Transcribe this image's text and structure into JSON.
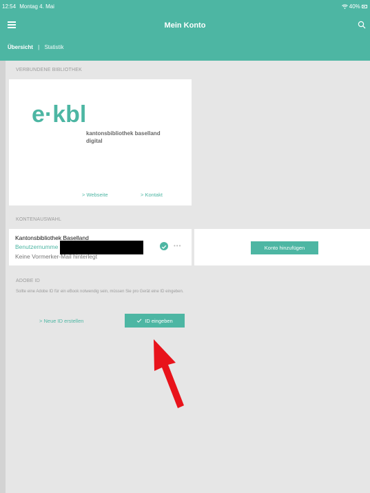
{
  "status_bar": {
    "time": "12:54",
    "date": "Montag 4. Mai",
    "battery": "40%"
  },
  "header": {
    "title": "Mein Konto",
    "tabs": [
      {
        "label": "Übersicht",
        "active": true
      },
      {
        "label": "Statistik",
        "active": false
      }
    ],
    "separator": "|"
  },
  "library": {
    "section_label": "VERBUNDENE BIBLIOTHEK",
    "logo_mark": "e·kbl",
    "logo_line1": "kantonsbibliothek baselland",
    "logo_line2": "digital",
    "website_link": "Webseite",
    "contact_link": "Kontakt"
  },
  "accounts": {
    "section_label": "KONTENAUSWAHL",
    "items": [
      {
        "name": "Kantonsbibliothek Baselland",
        "username_label": "Benutzernumme",
        "note": "Keine Vormerker-Mail hinterlegt",
        "selected": true
      }
    ],
    "add_button": "Konto hinzufügen"
  },
  "adobe": {
    "section_label": "ADOBE ID",
    "description": "Sollte eine Adobe ID für ein eBook notwendig sein, müssen Sie pro Gerät eine ID eingeben.",
    "new_id_link": "Neue ID erstellen",
    "enter_id_button": "ID eingeben"
  },
  "colors": {
    "accent": "#4db6a3",
    "background": "#e6e6e6",
    "annotation_arrow": "#e8131b"
  },
  "icons": {
    "menu": "hamburger-menu-icon",
    "search": "search-icon",
    "wifi": "wifi-icon",
    "battery": "battery-icon",
    "check": "checkmark-icon",
    "more": "more-dots-icon",
    "chevron": "chevron-right-icon"
  }
}
